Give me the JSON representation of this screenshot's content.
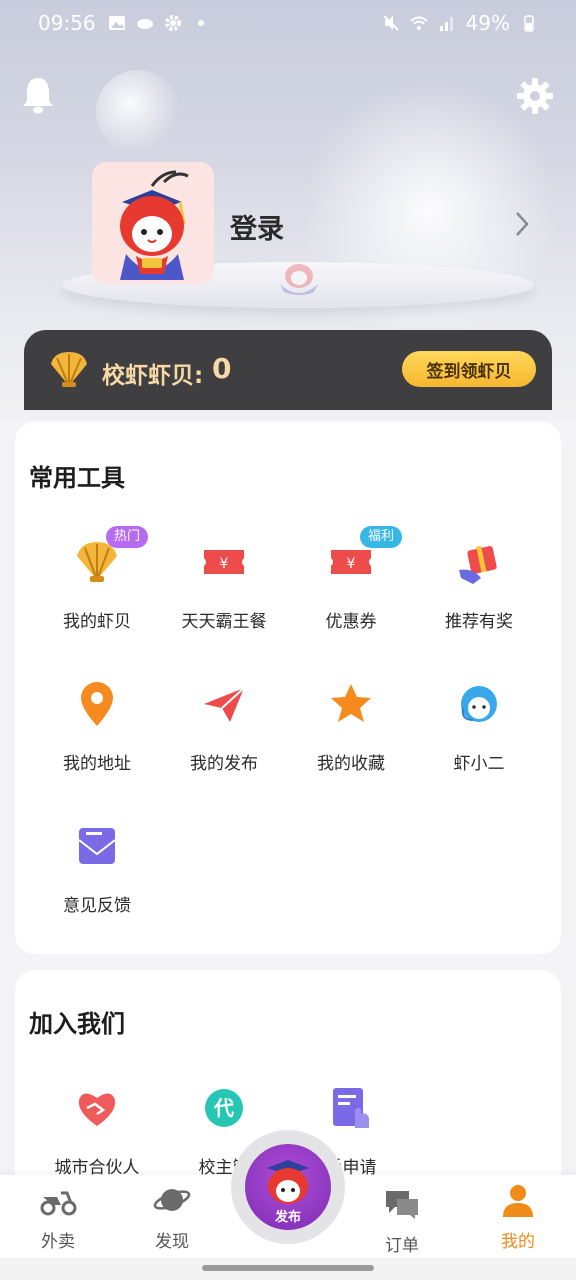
{
  "status_bar": {
    "time": "09:56",
    "battery": "49%"
  },
  "header": {
    "login_label": "登录"
  },
  "coin_bar": {
    "label": "校虾虾贝:",
    "value": "0",
    "sign_button": "签到领虾贝"
  },
  "tools": {
    "title": "常用工具",
    "items": [
      {
        "label": "我的虾贝",
        "icon": "shell-icon",
        "badge": "热门"
      },
      {
        "label": "天天霸王餐",
        "icon": "ticket-icon",
        "badge": ""
      },
      {
        "label": "优惠券",
        "icon": "coupon-icon",
        "badge": "福利"
      },
      {
        "label": "推荐有奖",
        "icon": "gift-icon",
        "badge": ""
      },
      {
        "label": "我的地址",
        "icon": "location-pin-icon",
        "badge": ""
      },
      {
        "label": "我的发布",
        "icon": "paper-plane-icon",
        "badge": ""
      },
      {
        "label": "我的收藏",
        "icon": "star-icon",
        "badge": ""
      },
      {
        "label": "虾小二",
        "icon": "customer-service-icon",
        "badge": ""
      },
      {
        "label": "意见反馈",
        "icon": "feedback-envelope-icon",
        "badge": ""
      }
    ]
  },
  "join": {
    "title": "加入我们",
    "items": [
      {
        "label": "城市合伙人",
        "icon": "handshake-heart-icon"
      },
      {
        "label": "校主管",
        "icon": "dai-badge-icon"
      },
      {
        "label": "手申请",
        "icon": "apply-hand-icon"
      }
    ]
  },
  "bottom_nav": {
    "items": [
      {
        "label": "外卖",
        "icon": "scooter-icon"
      },
      {
        "label": "发现",
        "icon": "planet-icon"
      },
      {
        "label": "订单",
        "icon": "chat-bubbles-icon"
      },
      {
        "label": "我的",
        "icon": "person-icon"
      }
    ],
    "publish_label": "发布",
    "active": "我的"
  },
  "colors": {
    "accent_orange": "#f18b1a",
    "sign_yellow": "#f6b72e",
    "coinbar_bg": "#3f3f41",
    "hot_badge": "#b66cf0",
    "welfare_badge": "#38b7e6"
  }
}
